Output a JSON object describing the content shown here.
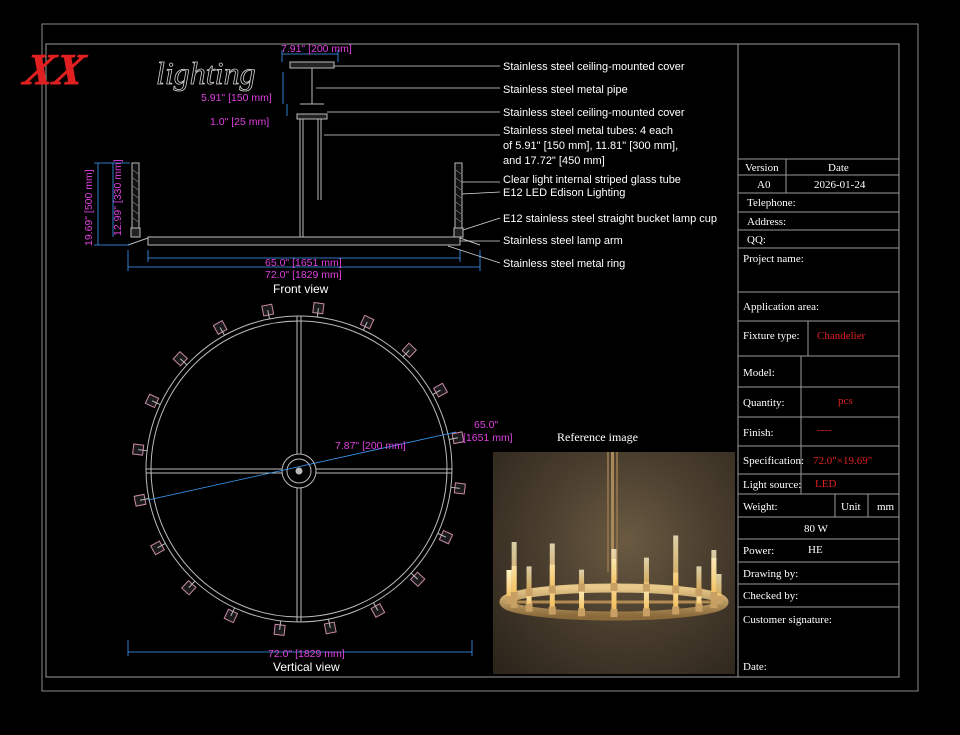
{
  "logo": {
    "mark": "XX",
    "word": "lighting"
  },
  "front_view": {
    "caption": "Front view",
    "dims": {
      "cover_width": "7.91\" [200 mm]",
      "pipe_length": "5.91\" [150 mm]",
      "cover_gap": "1.0\" [25 mm]",
      "total_height": "19.69\" [500 mm]",
      "tube_height": "12.99\" [330 mm]",
      "inner_span": "65.0\" [1651 mm]",
      "outer_span": "72.0\" [1829 mm]"
    },
    "callouts": [
      "Stainless steel ceiling-mounted cover",
      "Stainless steel metal pipe",
      "Stainless steel ceiling-mounted cover",
      "Stainless steel metal tubes: 4 each",
      "of 5.91\" [150 mm], 11.81\" [300 mm],",
      "and 17.72\" [450 mm]",
      "Clear light internal striped glass tube",
      "E12 LED Edison Lighting",
      "E12 stainless steel straight bucket lamp cup",
      "Stainless steel lamp arm",
      "Stainless steel metal ring"
    ]
  },
  "vertical_view": {
    "caption": "Vertical view",
    "dims": {
      "hub": "7.87\" [200 mm]",
      "inner_a": "65.0\"",
      "inner_b": "[1651 mm]",
      "outer": "72.0\" [1829 mm]"
    }
  },
  "reference": {
    "caption": "Reference image"
  },
  "title_block": {
    "version_label": "Version",
    "date_label": "Date",
    "version": "A0",
    "date": "2026-01-24",
    "telephone": "Telephone:",
    "address": "Address:",
    "qq": "QQ:",
    "project_name": "Project name:",
    "application_area": "Application area:",
    "fixture_type_label": "Fixture type:",
    "fixture_type": "Chandelier",
    "model_label": "Model:",
    "quantity_label": "Quantity:",
    "quantity": "pcs",
    "finish_label": "Finish:",
    "finish": "----",
    "spec_label": "Specification:",
    "spec": "72.0\"×19.69\"",
    "light_source_label": "Light source:",
    "light_source": "LED",
    "weight_label": "Weight:",
    "unit_label": "Unit",
    "unit": "mm",
    "wattage": "80 W",
    "power_label": "Power:",
    "power": "HE",
    "drawing_by": "Drawing by:",
    "checked_by": "Checked by:",
    "customer_signature": "Customer signature:",
    "date_field": "Date:"
  },
  "colors": {
    "dimension": "#e040e0",
    "leader": "#3ea0ff",
    "frame": "#9a9a9a",
    "accent_red": "#e02020"
  }
}
